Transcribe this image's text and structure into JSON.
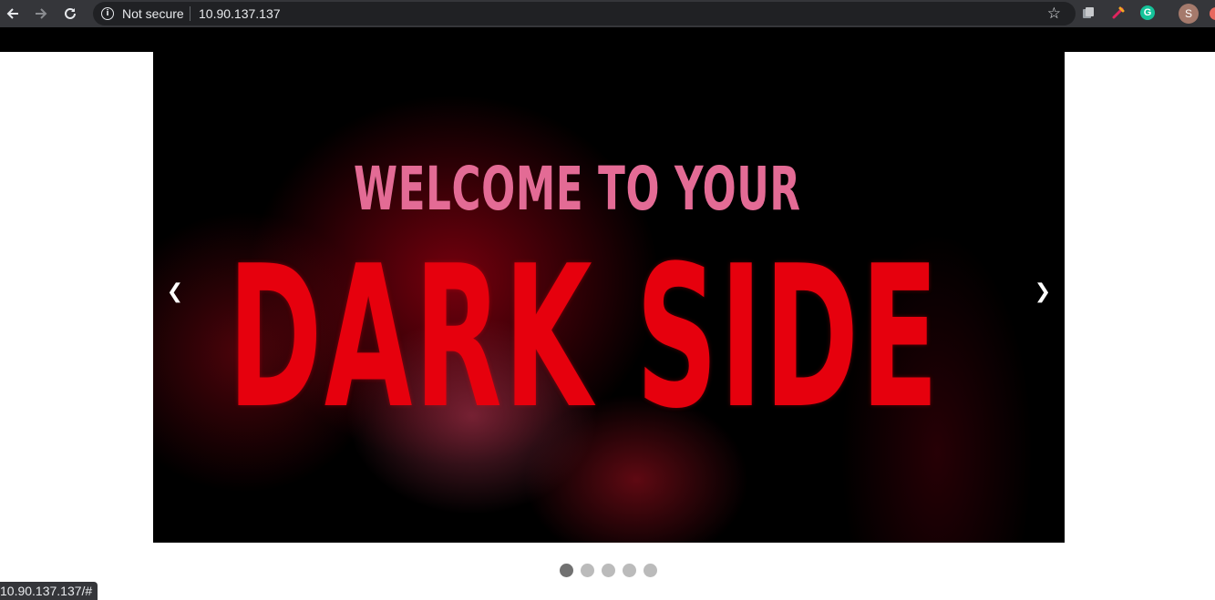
{
  "browser": {
    "security_label": "Not secure",
    "url": "10.90.137.137",
    "status_url": "10.90.137.137/#",
    "profile_initial": "S",
    "icons": {
      "back": "arrow-left-icon",
      "forward": "arrow-right-icon",
      "reload": "reload-icon",
      "info": "info-icon",
      "star": "star-icon"
    },
    "extensions": [
      "puzzle-extension-icon",
      "pen-extension-icon",
      "grammarly-icon"
    ],
    "accent": "#35363a"
  },
  "carousel": {
    "slide_text_line1": "WELCOME TO YOUR",
    "slide_text_line2": "DARK SIDE",
    "prev_label": "❮",
    "next_label": "❯",
    "dots": [
      {
        "active": true
      },
      {
        "active": false
      },
      {
        "active": false
      },
      {
        "active": false
      },
      {
        "active": false
      }
    ],
    "active_index": 0,
    "colors": {
      "title": "#e6000d",
      "subtitle": "#e36b95",
      "dot": "#bbbbbb",
      "dot_active": "#717171"
    }
  }
}
